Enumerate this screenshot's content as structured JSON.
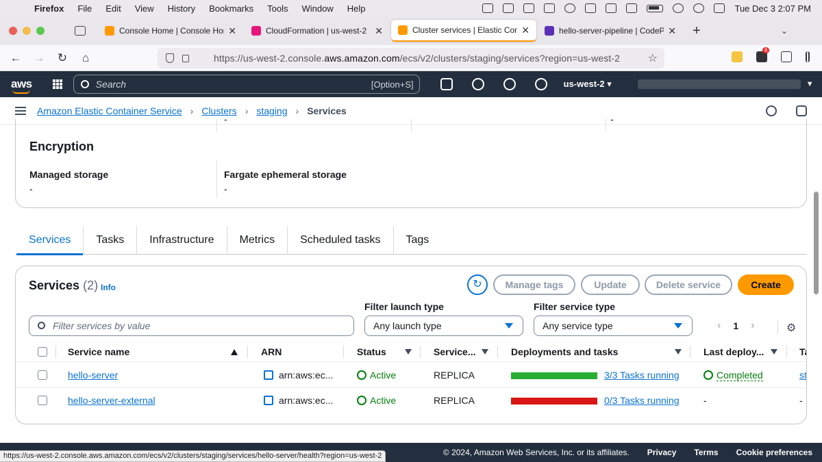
{
  "menubar": {
    "items": [
      "Firefox",
      "File",
      "Edit",
      "View",
      "History",
      "Bookmarks",
      "Tools",
      "Window",
      "Help"
    ],
    "datetime": "Tue Dec 3  2:07 PM"
  },
  "browser": {
    "tabs": [
      {
        "title": "Console Home | Console Home",
        "favicon_color": "#ff9900",
        "active": false
      },
      {
        "title": "CloudFormation | us-west-2",
        "favicon_color": "#e7157b",
        "active": false
      },
      {
        "title": "Cluster services | Elastic Contai",
        "favicon_color": "#ff9900",
        "active": true
      },
      {
        "title": "hello-server-pipeline | CodePipe",
        "favicon_color": "#5a30b5",
        "active": false
      }
    ],
    "url_prefix": "https://us-west-2.console.",
    "url_domain": "aws.amazon.com",
    "url_suffix": "/ecs/v2/clusters/staging/services?region=us-west-2",
    "extension_badge": "6",
    "status_url": "https://us-west-2.console.aws.amazon.com/ecs/v2/clusters/staging/services/hello-server/health?region=us-west-2"
  },
  "aws_header": {
    "logo": "aws",
    "search_placeholder": "Search",
    "search_shortcut": "[Option+S]",
    "region": "us-west-2"
  },
  "breadcrumb": {
    "items": [
      "Amazon Elastic Container Service",
      "Clusters",
      "staging"
    ],
    "current": "Services"
  },
  "encryption": {
    "title": "Encryption",
    "managed_storage_label": "Managed storage",
    "managed_storage_value": "-",
    "fargate_label": "Fargate ephemeral storage",
    "fargate_value": "-",
    "top_dash": "-"
  },
  "content_tabs": [
    "Services",
    "Tasks",
    "Infrastructure",
    "Metrics",
    "Scheduled tasks",
    "Tags"
  ],
  "services": {
    "title": "Services",
    "count": "(2)",
    "info": "Info",
    "buttons": {
      "manage_tags": "Manage tags",
      "update": "Update",
      "delete": "Delete service",
      "create": "Create"
    },
    "filter_placeholder": "Filter services by value",
    "filter_launch_label": "Filter launch type",
    "filter_launch_value": "Any launch type",
    "filter_service_label": "Filter service type",
    "filter_service_value": "Any service type",
    "page": "1",
    "columns": [
      "Service name",
      "ARN",
      "Status",
      "Service...",
      "Deployments and tasks",
      "Last deploy...",
      "Ta"
    ],
    "rows": [
      {
        "name": "hello-server",
        "arn": "arn:aws:ec...",
        "status": "Active",
        "service_type": "REPLICA",
        "tasks": "3/3 Tasks running",
        "task_fraction": 1.0,
        "bar_color": "#29ad32",
        "last_deploy": "Completed",
        "extra": "st"
      },
      {
        "name": "hello-server-external",
        "arn": "arn:aws:ec...",
        "status": "Active",
        "service_type": "REPLICA",
        "tasks": "0/3 Tasks running",
        "task_fraction": 0.0,
        "bar_color": "#d91515",
        "last_deploy": "-",
        "extra": "-"
      }
    ]
  },
  "footer": {
    "copyright": "© 2024, Amazon Web Services, Inc. or its affiliates.",
    "links": [
      "Privacy",
      "Terms",
      "Cookie preferences"
    ]
  }
}
